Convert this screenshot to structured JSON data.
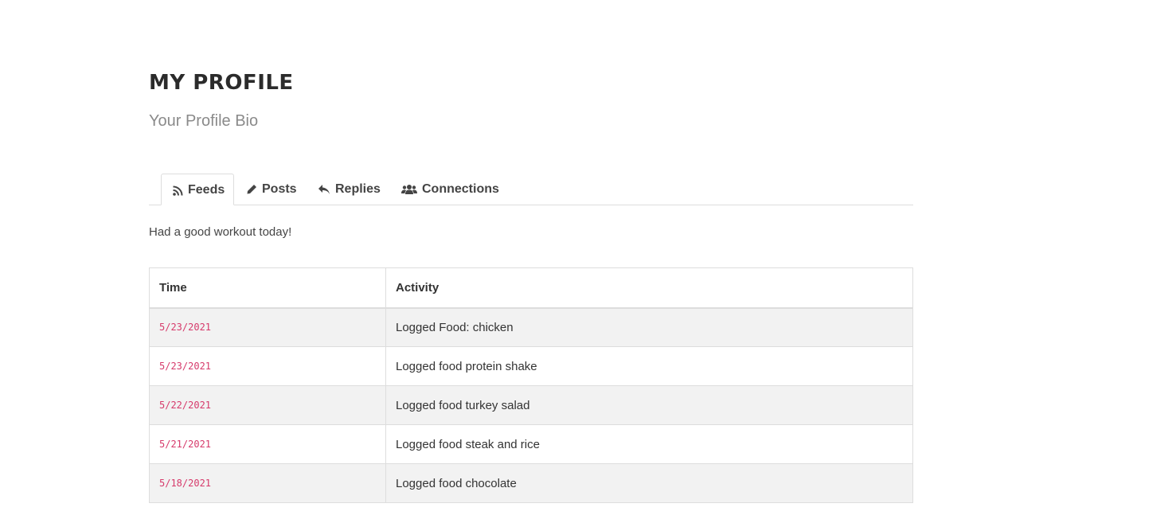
{
  "header": {
    "title": "MY PROFILE",
    "bio": "Your Profile Bio"
  },
  "tabs": [
    {
      "label": "Feeds",
      "icon": "rss-icon",
      "active": true
    },
    {
      "label": "Posts",
      "icon": "pencil-icon",
      "active": false
    },
    {
      "label": "Replies",
      "icon": "reply-icon",
      "active": false
    },
    {
      "label": "Connections",
      "icon": "users-icon",
      "active": false
    }
  ],
  "feed": {
    "post_text": "Had a good workout today!",
    "columns": [
      "Time",
      "Activity"
    ],
    "rows": [
      {
        "time": "5/23/2021",
        "activity": "Logged Food: chicken"
      },
      {
        "time": "5/23/2021",
        "activity": "Logged food protein shake"
      },
      {
        "time": "5/22/2021",
        "activity": "Logged food turkey salad"
      },
      {
        "time": "5/21/2021",
        "activity": "Logged food steak and rice"
      },
      {
        "time": "5/18/2021",
        "activity": "Logged food chocolate"
      }
    ]
  },
  "colors": {
    "time_text": "#d63a6b",
    "stripe": "#f2f2f2",
    "border": "#dddddd"
  }
}
